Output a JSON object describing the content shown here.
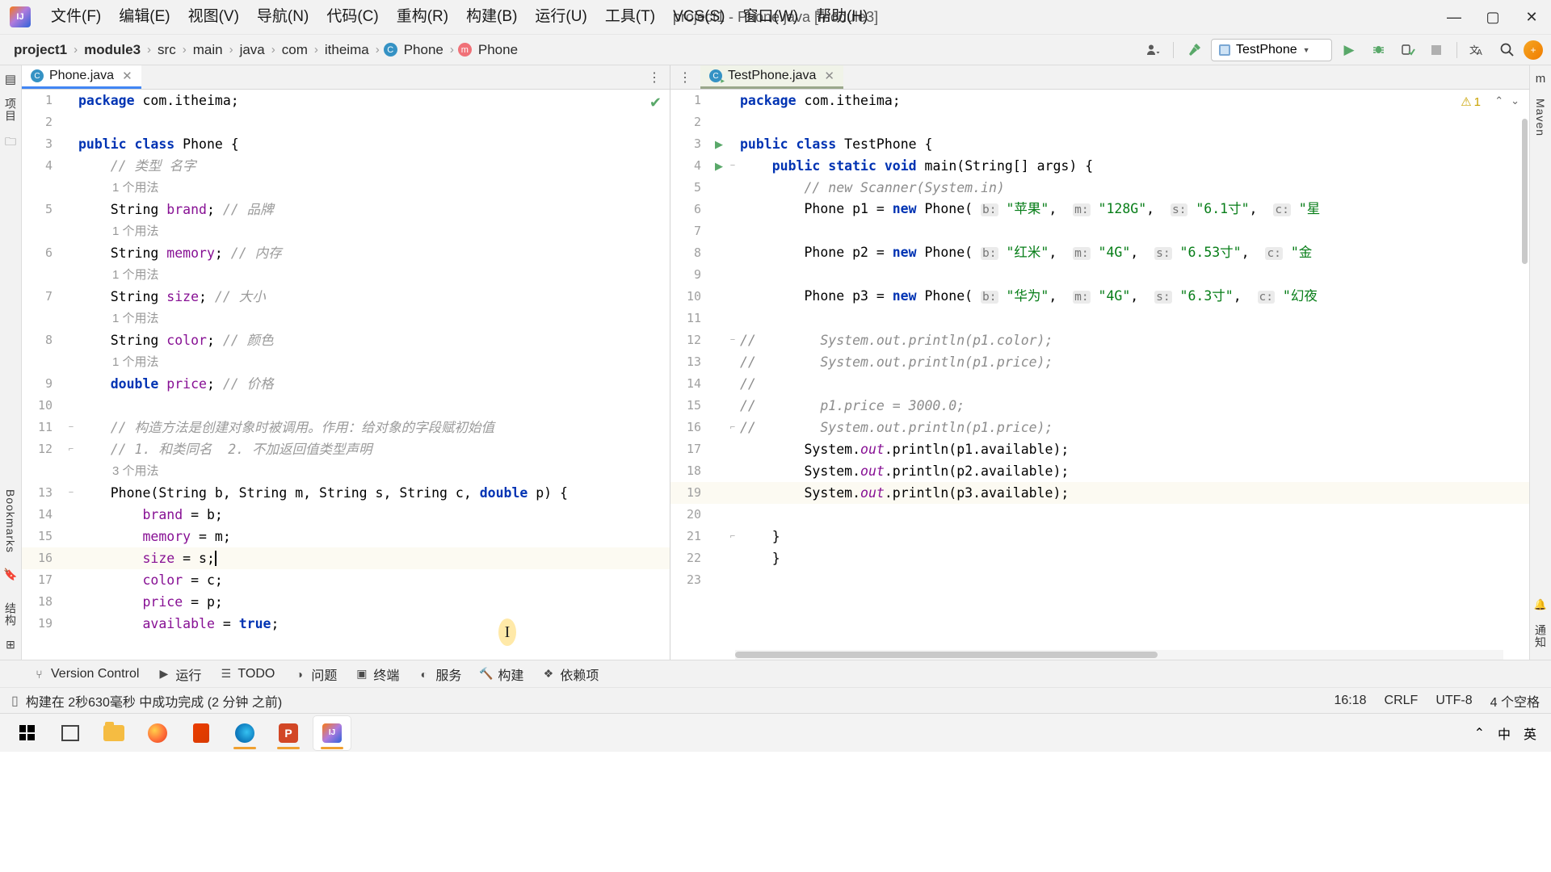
{
  "titlebar": {
    "logo": "intellij-logo",
    "menus": [
      "文件(F)",
      "编辑(E)",
      "视图(V)",
      "导航(N)",
      "代码(C)",
      "重构(R)",
      "构建(B)",
      "运行(U)",
      "工具(T)",
      "VCS(S)",
      "窗口(W)",
      "帮助(H)"
    ],
    "window_title": "project1 - Phone.java [module3]",
    "minimize": "—",
    "maximize": "▢",
    "close": "✕"
  },
  "navbar": {
    "breadcrumbs": [
      {
        "label": "project1",
        "bold": true,
        "icon": ""
      },
      {
        "label": "module3",
        "bold": true,
        "icon": ""
      },
      {
        "label": "src",
        "bold": false,
        "icon": ""
      },
      {
        "label": "main",
        "bold": false,
        "icon": ""
      },
      {
        "label": "java",
        "bold": false,
        "icon": ""
      },
      {
        "label": "com",
        "bold": false,
        "icon": ""
      },
      {
        "label": "itheima",
        "bold": false,
        "icon": ""
      },
      {
        "label": "Phone",
        "bold": false,
        "icon": "C"
      },
      {
        "label": "Phone",
        "bold": false,
        "icon": "m"
      }
    ],
    "separator": "›",
    "run_config_name": "TestPhone",
    "icons": {
      "account": "account-icon",
      "build": "hammer-icon",
      "run": "▶",
      "debug": "debug-icon",
      "coverage": "coverage-icon",
      "stop": "stop-icon",
      "translate": "translate-icon",
      "search": "search-icon",
      "avatar": "avatar-icon"
    }
  },
  "left_rail": {
    "project_label": "项目",
    "bookmarks_label": "Bookmarks",
    "structure_label": "结构"
  },
  "right_rail": {
    "maven_label": "Maven",
    "notify_label": "通知"
  },
  "left_editor": {
    "tab": {
      "name": "Phone.java",
      "icon": "C",
      "close": "✕"
    },
    "options_icon": "⋮",
    "status_check": "✔",
    "lines": [
      {
        "n": "1",
        "type": "code",
        "fold": "",
        "html": "<span class='kw'>package</span> com.itheima;"
      },
      {
        "n": "2",
        "type": "code",
        "fold": "",
        "html": ""
      },
      {
        "n": "3",
        "type": "code",
        "fold": "",
        "html": "<span class='kw'>public</span> <span class='kw'>class</span> Phone {"
      },
      {
        "n": "4",
        "type": "code",
        "fold": "",
        "html": "    <span class='cmtcn'>// 类型 名字</span>"
      },
      {
        "n": "",
        "type": "hint",
        "fold": "",
        "html": "1 个用法"
      },
      {
        "n": "5",
        "type": "code",
        "fold": "",
        "html": "    String <span class='fld'>brand</span>; <span class='cmtcn'>// 品牌</span>"
      },
      {
        "n": "",
        "type": "hint",
        "fold": "",
        "html": "1 个用法"
      },
      {
        "n": "6",
        "type": "code",
        "fold": "",
        "html": "    String <span class='fld'>memory</span>; <span class='cmtcn'>// 内存</span>"
      },
      {
        "n": "",
        "type": "hint",
        "fold": "",
        "html": "1 个用法"
      },
      {
        "n": "7",
        "type": "code",
        "fold": "",
        "html": "    String <span class='fld'>size</span>; <span class='cmtcn'>// 大小</span>"
      },
      {
        "n": "",
        "type": "hint",
        "fold": "",
        "html": "1 个用法"
      },
      {
        "n": "8",
        "type": "code",
        "fold": "",
        "html": "    String <span class='fld'>color</span>; <span class='cmtcn'>// 颜色</span>"
      },
      {
        "n": "",
        "type": "hint",
        "fold": "",
        "html": "1 个用法"
      },
      {
        "n": "9",
        "type": "code",
        "fold": "",
        "html": "    <span class='kw'>double</span> <span class='fld'>price</span>; <span class='cmtcn'>// 价格</span>"
      },
      {
        "n": "10",
        "type": "code",
        "fold": "",
        "html": ""
      },
      {
        "n": "11",
        "type": "code",
        "fold": "−",
        "html": "    <span class='cmtcn'>// 构造方法是创建对象时被调用。作用：给对象的字段赋初始值</span>"
      },
      {
        "n": "12",
        "type": "code",
        "fold": "⌐",
        "html": "    <span class='cmtcn'>// 1. 和类同名  2. 不加返回值类型声明</span>"
      },
      {
        "n": "",
        "type": "hint",
        "fold": "",
        "html": "3 个用法"
      },
      {
        "n": "13",
        "type": "code",
        "fold": "−",
        "html": "    Phone(String b, String m, String s, String c, <span class='kw'>double</span> p) {"
      },
      {
        "n": "14",
        "type": "code",
        "fold": "",
        "html": "        <span class='fld'>brand</span> = b;"
      },
      {
        "n": "15",
        "type": "code",
        "fold": "",
        "html": "        <span class='fld'>memory</span> = m;"
      },
      {
        "n": "16",
        "type": "code",
        "fold": "",
        "html": "        <span class='fld'>size</span> = s;",
        "current": true,
        "caret": true
      },
      {
        "n": "17",
        "type": "code",
        "fold": "",
        "html": "        <span class='fld'>color</span> = c;"
      },
      {
        "n": "18",
        "type": "code",
        "fold": "",
        "html": "        <span class='fld'>price</span> = p;"
      },
      {
        "n": "19",
        "type": "code",
        "fold": "",
        "html": "        <span class='fld'>available</span> = <span class='kw'>true</span>;"
      }
    ]
  },
  "right_editor": {
    "tab": {
      "name": "TestPhone.java",
      "icon": "C",
      "close": "✕"
    },
    "options_icon": "⋮",
    "warning_count": "1",
    "warning_icon": "⚠",
    "inspect_up": "⌃",
    "inspect_down": "⌄",
    "lines": [
      {
        "n": "1",
        "run": "",
        "fold": "",
        "html": "<span class='kw'>package</span> com.itheima;"
      },
      {
        "n": "2",
        "run": "",
        "fold": "",
        "html": ""
      },
      {
        "n": "3",
        "run": "▶",
        "fold": "",
        "html": "<span class='kw'>public</span> <span class='kw'>class</span> TestPhone {"
      },
      {
        "n": "4",
        "run": "▶",
        "fold": "−",
        "html": "    <span class='kw'>public</span> <span class='kw'>static</span> <span class='kw'>void</span> <span class='cls'>main</span>(String[] args) {"
      },
      {
        "n": "5",
        "run": "",
        "fold": "",
        "html": "        <span class='cmt'>// new Scanner(System.in)</span>"
      },
      {
        "n": "6",
        "run": "",
        "fold": "",
        "html": "        Phone p1 = <span class='kw'>new</span> Phone( <span class='inlay'>b:</span> <span class='str'>\"苹果\"</span>,  <span class='inlay'>m:</span> <span class='str'>\"128G\"</span>,  <span class='inlay'>s:</span> <span class='str'>\"6.1寸\"</span>,  <span class='inlay'>c:</span> <span class='str'>\"星</span>"
      },
      {
        "n": "7",
        "run": "",
        "fold": "",
        "html": ""
      },
      {
        "n": "8",
        "run": "",
        "fold": "",
        "html": "        Phone p2 = <span class='kw'>new</span> Phone( <span class='inlay'>b:</span> <span class='str'>\"红米\"</span>,  <span class='inlay'>m:</span> <span class='str'>\"4G\"</span>,  <span class='inlay'>s:</span> <span class='str'>\"6.53寸\"</span>,  <span class='inlay'>c:</span> <span class='str'>\"金</span>"
      },
      {
        "n": "9",
        "run": "",
        "fold": "",
        "html": ""
      },
      {
        "n": "10",
        "run": "",
        "fold": "",
        "html": "        Phone p3 = <span class='kw'>new</span> Phone( <span class='inlay'>b:</span> <span class='str'>\"华为\"</span>,  <span class='inlay'>m:</span> <span class='str'>\"4G\"</span>,  <span class='inlay'>s:</span> <span class='str'>\"6.3寸\"</span>,  <span class='inlay'>c:</span> <span class='str'>\"幻夜</span>"
      },
      {
        "n": "11",
        "run": "",
        "fold": "",
        "html": ""
      },
      {
        "n": "12",
        "run": "",
        "fold": "−",
        "html": "<span class='cmt'>//</span>        <span class='cmt'>System.out.println(p1.color);</span>",
        "comment_gutter": true
      },
      {
        "n": "13",
        "run": "",
        "fold": "",
        "html": "<span class='cmt'>//</span>        <span class='cmt'>System.out.println(p1.price);</span>",
        "comment_gutter": true
      },
      {
        "n": "14",
        "run": "",
        "fold": "",
        "html": "<span class='cmt'>//</span>",
        "comment_gutter": true
      },
      {
        "n": "15",
        "run": "",
        "fold": "",
        "html": "<span class='cmt'>//</span>        <span class='cmt'>p1.price = 3000.0;</span>",
        "comment_gutter": true
      },
      {
        "n": "16",
        "run": "",
        "fold": "⌐",
        "html": "<span class='cmt'>//</span>        <span class='cmt'>System.out.println(p1.price);</span>",
        "comment_gutter": true
      },
      {
        "n": "17",
        "run": "",
        "fold": "",
        "html": "        System.<span class='stat'>out</span>.println(p1.available);"
      },
      {
        "n": "18",
        "run": "",
        "fold": "",
        "html": "        System.<span class='stat'>out</span>.println(p2.available);"
      },
      {
        "n": "19",
        "run": "",
        "fold": "",
        "html": "        System.<span class='stat'>out</span>.println(p3.available);",
        "current": true
      },
      {
        "n": "20",
        "run": "",
        "fold": "",
        "html": ""
      },
      {
        "n": "21",
        "run": "",
        "fold": "⌐",
        "html": "    }"
      },
      {
        "n": "22",
        "run": "",
        "fold": "",
        "html": "    }"
      },
      {
        "n": "23",
        "run": "",
        "fold": "",
        "html": ""
      }
    ]
  },
  "bottom_toolwindows": [
    {
      "label": "Version Control",
      "icon": "⑂"
    },
    {
      "label": "运行",
      "icon": "▶"
    },
    {
      "label": "TODO",
      "icon": "☰"
    },
    {
      "label": "问题",
      "icon": "◑"
    },
    {
      "label": "终端",
      "icon": "▣"
    },
    {
      "label": "服务",
      "icon": "◐"
    },
    {
      "label": "构建",
      "icon": "🔨"
    },
    {
      "label": "依赖项",
      "icon": "❖"
    }
  ],
  "statusbar": {
    "icon": "▯",
    "message": "构建在 2秒630毫秒 中成功完成 (2 分钟 之前)",
    "time": "16:18",
    "line_separator": "CRLF",
    "encoding": "UTF-8",
    "indent": "4 个空格"
  },
  "taskbar": {
    "apps": [
      {
        "name": "start-button",
        "icon": "windows-logo"
      },
      {
        "name": "task-view",
        "icon": "task-view-icon"
      },
      {
        "name": "file-explorer",
        "icon": "folder-icon"
      },
      {
        "name": "firefox",
        "icon": "firefox-icon"
      },
      {
        "name": "office",
        "icon": "office-icon"
      },
      {
        "name": "edge",
        "icon": "edge-icon"
      },
      {
        "name": "powerpoint",
        "icon": "powerpoint-icon"
      },
      {
        "name": "intellij-idea",
        "icon": "intellij-icon"
      }
    ],
    "tray": {
      "chevron": "⌃",
      "ime_layout": "中",
      "ime_lang": "英"
    }
  }
}
